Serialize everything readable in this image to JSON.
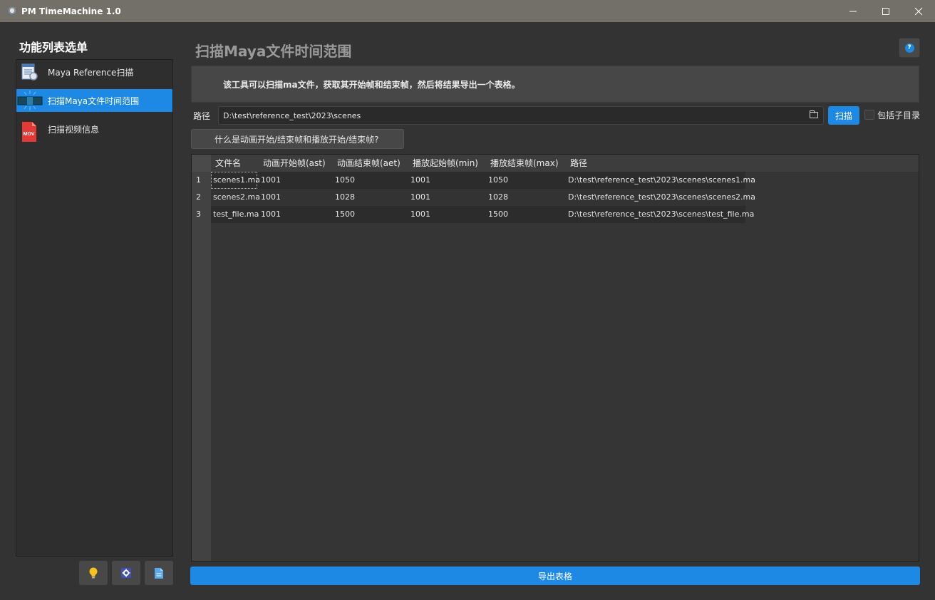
{
  "window": {
    "title": "PM TimeMachine 1.0",
    "controls": [
      "minimize-icon",
      "maximize-icon",
      "close-icon"
    ]
  },
  "sidebar": {
    "title": "功能列表选单",
    "items": [
      {
        "label": "Maya Reference扫描",
        "icon": "document-scan-icon",
        "active": false
      },
      {
        "label": "扫描Maya文件时间范围",
        "icon": "timeline-scan-icon",
        "active": true
      },
      {
        "label": "扫描视频信息",
        "icon": "mov-file-icon",
        "active": false
      }
    ],
    "bottom_buttons": [
      "lightbulb-icon",
      "settings-icon",
      "document-icon"
    ]
  },
  "main": {
    "title": "扫描Maya文件时间范围",
    "description": "该工具可以扫描ma文件，获取其开始帧和结束帧，然后将结果导出一个表格。",
    "help_icon": "?",
    "path_label": "路径",
    "path_value": "D:\\test\\reference_test\\2023\\scenes",
    "scan_button": "扫描",
    "include_subdirs_label": "包括子目录",
    "include_subdirs_checked": false,
    "faq_button": "什么是动画开始/结束帧和播放开始/结束帧?",
    "export_button": "导出表格"
  },
  "table": {
    "columns": [
      "文件名",
      "动画开始帧(ast)",
      "动画结束帧(aet)",
      "播放起始帧(min)",
      "播放结束帧(max)",
      "路径"
    ],
    "rows": [
      {
        "num": "1",
        "cells": [
          "scenes1.ma",
          "1001",
          "1050",
          "1001",
          "1050",
          "D:\\test\\reference_test\\2023\\scenes\\scenes1.ma"
        ]
      },
      {
        "num": "2",
        "cells": [
          "scenes2.ma",
          "1001",
          "1028",
          "1001",
          "1028",
          "D:\\test\\reference_test\\2023\\scenes\\scenes2.ma"
        ]
      },
      {
        "num": "3",
        "cells": [
          "test_file.ma",
          "1001",
          "1500",
          "1001",
          "1500",
          "D:\\test\\reference_test\\2023\\scenes\\test_file.ma"
        ]
      }
    ]
  },
  "colors": {
    "accent": "#1e88e5",
    "titlebar": "#736f69",
    "background": "#333333"
  }
}
